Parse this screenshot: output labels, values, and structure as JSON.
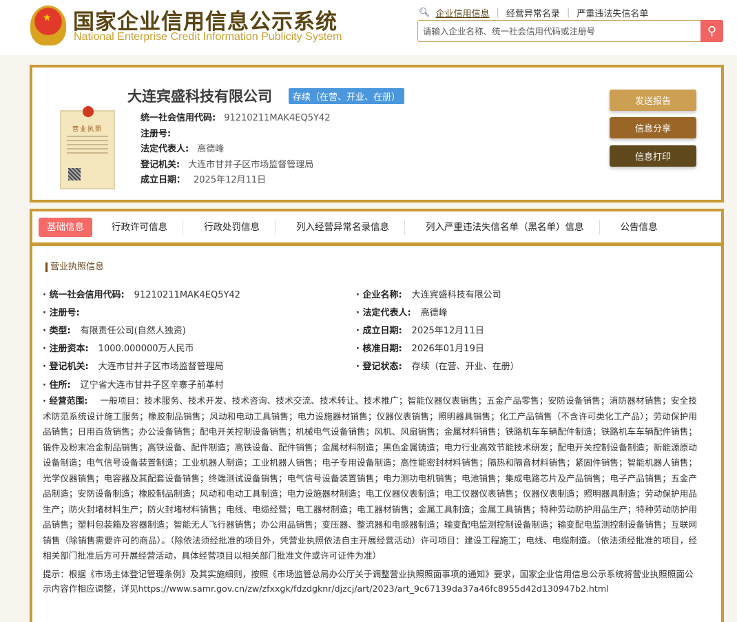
{
  "header": {
    "title_cn": "国家企业信用信息公示系统",
    "title_en": "National Enterprise Credit Information Publicity System",
    "links": [
      "企业信用信息",
      "经营异常名录",
      "严重违法失信名单"
    ],
    "search_placeholder": "请输入企业名称、统一社会信用代码或注册号"
  },
  "company": {
    "name": "大连宾盛科技有限公司",
    "status": "存续（在营、开业、在册）",
    "license_title": "营业执照",
    "fields": [
      {
        "label": "统一社会信用代码:",
        "value": "91210211MAK4EQ5Y42"
      },
      {
        "label": "注册号:",
        "value": ""
      },
      {
        "label": "法定代表人:",
        "value": "高德峰"
      },
      {
        "label": "登记机关:",
        "value": "大连市甘井子区市场监督管理局"
      },
      {
        "label": "成立日期：",
        "value": "2025年12月11日"
      }
    ],
    "buttons": [
      "发送报告",
      "信息分享",
      "信息打印"
    ]
  },
  "tabs": [
    "基础信息",
    "行政许可信息",
    "行政处罚信息",
    "列入经营异常名录信息",
    "列入严重违法失信名单（黑名单）信息",
    "公告信息"
  ],
  "section_title": "营业执照信息",
  "info": {
    "left": [
      {
        "label": "统一社会信用代码:",
        "value": "91210211MAK4EQ5Y42"
      },
      {
        "label": "注册号:",
        "value": ""
      },
      {
        "label": "类型:",
        "value": "有限责任公司(自然人独资)"
      },
      {
        "label": "注册资本:",
        "value": "1000.000000万人民币"
      },
      {
        "label": "登记机关:",
        "value": "大连市甘井子区市场监督管理局"
      },
      {
        "label": "住所:",
        "value": "辽宁省大连市甘井子区辛寨子前革村"
      }
    ],
    "right": [
      {
        "label": "企业名称:",
        "value": "大连宾盛科技有限公司"
      },
      {
        "label": "法定代表人:",
        "value": "高德峰"
      },
      {
        "label": "成立日期:",
        "value": "2025年12月11日"
      },
      {
        "label": "核准日期:",
        "value": "2026年01月19日"
      },
      {
        "label": "登记状态:",
        "value": "存续（在营、开业、在册）"
      }
    ],
    "scope_label": "经营范围:",
    "scope": "一般项目：技术服务、技术开发、技术咨询、技术交流、技术转让、技术推广；智能仪器仪表销售；五金产品零售；安防设备销售；消防器材销售；安全技术防范系统设计施工服务；橡胶制品销售；风动和电动工具销售；电力设施器材销售；仪器仪表销售；照明器具销售；化工产品销售（不含许可类化工产品）；劳动保护用品销售；日用百货销售；办公设备销售；配电开关控制设备销售；机械电气设备销售；风机、风扇销售；金属材料销售；铁路机车车辆配件制造；铁路机车车辆配件销售；锻件及粉末冶金制品销售；高铁设备、配件制造；高铁设备、配件销售；金属材料制造；黑色金属铸造；电力行业高效节能技术研发；配电开关控制设备制造；新能源原动设备制造；电气信号设备装置制造；工业机器人制造；工业机器人销售；电子专用设备制造；高性能密封材料销售；隔热和隔音材料销售；紧固件销售；智能机器人销售；光学仪器销售；电容器及其配套设备销售；终端测试设备销售；电气信号设备装置销售；电力测功电机销售；电池销售；集成电路芯片及产品销售；电子产品销售；五金产品制造；安防设备制造；橡胶制品制造；风动和电动工具制造；电力设施器材制造；电工仪器仪表制造；电工仪器仪表销售；仪器仪表制造；照明器具制造；劳动保护用品生产；防火封堵材料生产；防火封堵材料销售；电线、电缆经营；电工器材制造；电工器材销售；金属工具制造；金属工具销售；特种劳动防护用品生产；特种劳动防护用品销售；塑料包装箱及容器制造；智能无人飞行器销售；办公用品销售；变压器、整流器和电感器制造；输变配电监测控制设备制造；输变配电监测控制设备销售；互联网销售（除销售需要许可的商品）。（除依法须经批准的项目外，凭营业执照依法自主开展经营活动）许可项目：建设工程施工；电线、电缆制造。（依法须经批准的项目，经相关部门批准后方可开展经营活动，具体经营项目以相关部门批准文件或许可证件为准）",
    "hint": "提示：根据《市场主体登记管理条例》及其实施细则，按照《市场监管总局办公厅关于调整营业执照照面事项的通知》要求，国家企业信用信息公示系统将营业执照照面公示内容作相应调整，详见https://www.samr.gov.cn/zw/zfxxgk/fdzdgknr/djzcj/art/2023/art_9c67139da37a46fc8955d42d130947b2.html"
  }
}
